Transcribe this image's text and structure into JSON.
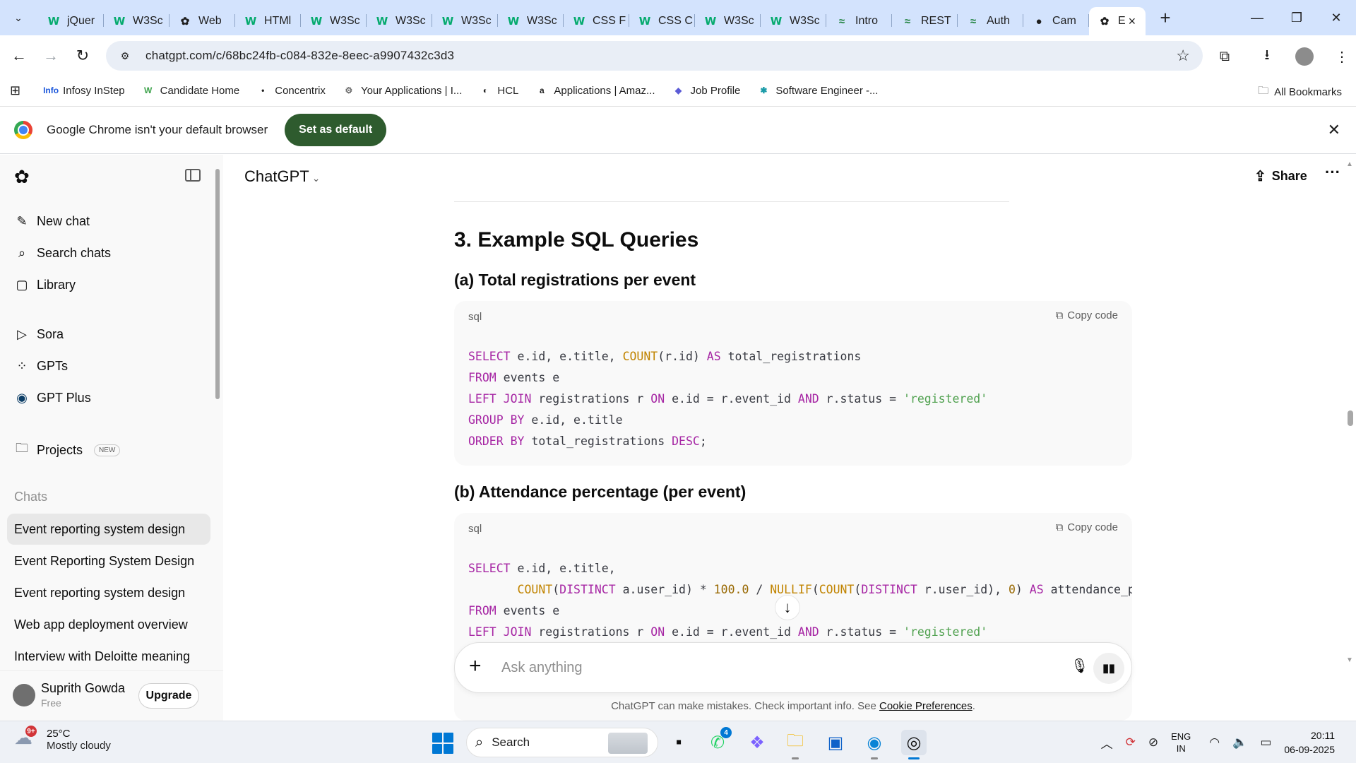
{
  "browser": {
    "tabs": [
      {
        "title": "jQuer",
        "icon": "w3schools-icon"
      },
      {
        "title": "W3Sc",
        "icon": "w3schools-icon"
      },
      {
        "title": "Web",
        "icon": "chatgpt-icon"
      },
      {
        "title": "HTMl",
        "icon": "w3schools-icon"
      },
      {
        "title": "W3Sc",
        "icon": "w3schools-icon"
      },
      {
        "title": "W3Sc",
        "icon": "w3schools-icon"
      },
      {
        "title": "W3Sc",
        "icon": "w3schools-icon"
      },
      {
        "title": "W3Sc",
        "icon": "w3schools-icon"
      },
      {
        "title": "CSS F",
        "icon": "w3schools-icon"
      },
      {
        "title": "CSS C",
        "icon": "w3schools-icon"
      },
      {
        "title": "W3Sc",
        "icon": "w3schools-icon"
      },
      {
        "title": "W3Sc",
        "icon": "w3schools-icon"
      },
      {
        "title": "Intro",
        "icon": "devsite-icon"
      },
      {
        "title": "REST",
        "icon": "devsite-icon"
      },
      {
        "title": "Auth",
        "icon": "devsite-icon"
      },
      {
        "title": "Cam",
        "icon": "github-icon"
      }
    ],
    "active_tab": {
      "title": "E"
    },
    "url": "chatgpt.com/c/68bc24fb-c084-832e-8eec-a9907432c3d3",
    "bookmarks": [
      {
        "label": "Infosy InStep",
        "icon_text": "Info"
      },
      {
        "label": "Candidate Home",
        "icon_text": "W"
      },
      {
        "label": "Concentrix",
        "icon_text": "•"
      },
      {
        "label": "Your Applications | I...",
        "icon_text": "⚙"
      },
      {
        "label": "HCL",
        "icon_text": "◐"
      },
      {
        "label": "Applications | Amaz...",
        "icon_text": "a"
      },
      {
        "label": "Job Profile",
        "icon_text": "◆"
      },
      {
        "label": "Software Engineer -...",
        "icon_text": "✱"
      }
    ],
    "all_bookmarks": "All Bookmarks",
    "infobar": {
      "message": "Google Chrome isn't your default browser",
      "button": "Set as default"
    }
  },
  "sidebar": {
    "nav": [
      {
        "label": "New chat",
        "icon": "✎"
      },
      {
        "label": "Search chats",
        "icon": "⌕"
      },
      {
        "label": "Library",
        "icon": "▢"
      }
    ],
    "tools": [
      {
        "label": "Sora",
        "icon": "▷"
      },
      {
        "label": "GPTs",
        "icon": "⁘"
      },
      {
        "label": "GPT Plus",
        "icon": "◉"
      }
    ],
    "projects": {
      "label": "Projects",
      "badge": "NEW"
    },
    "chats_header": "Chats",
    "chats": [
      "Event reporting system design",
      "Event Reporting System Design",
      "Event reporting system design",
      "Web app deployment overview",
      "Interview with Deloitte meaning"
    ],
    "user": {
      "name": "Suprith Gowda",
      "plan": "Free",
      "upgrade": "Upgrade"
    }
  },
  "main": {
    "model": "ChatGPT",
    "share": "Share",
    "heading": "3. Example SQL Queries",
    "sections": [
      {
        "title": "(a) Total registrations per event",
        "lang": "sql",
        "copy": "Copy code"
      },
      {
        "title": "(b) Attendance percentage (per event)",
        "lang": "sql",
        "copy": "Copy code"
      }
    ],
    "composer_placeholder": "Ask anything",
    "disclaimer": "ChatGPT can make mistakes. Check important info. See",
    "disclaimer_link": "Cookie Preferences",
    "disclaimer_end": "."
  },
  "taskbar": {
    "weather_temp": "25°C",
    "weather_desc": "Mostly cloudy",
    "weather_alert": "9+",
    "search": "Search",
    "whatsapp_count": "4",
    "lang_top": "ENG",
    "lang_bottom": "IN",
    "time": "20:11",
    "date": "06-09-2025"
  }
}
